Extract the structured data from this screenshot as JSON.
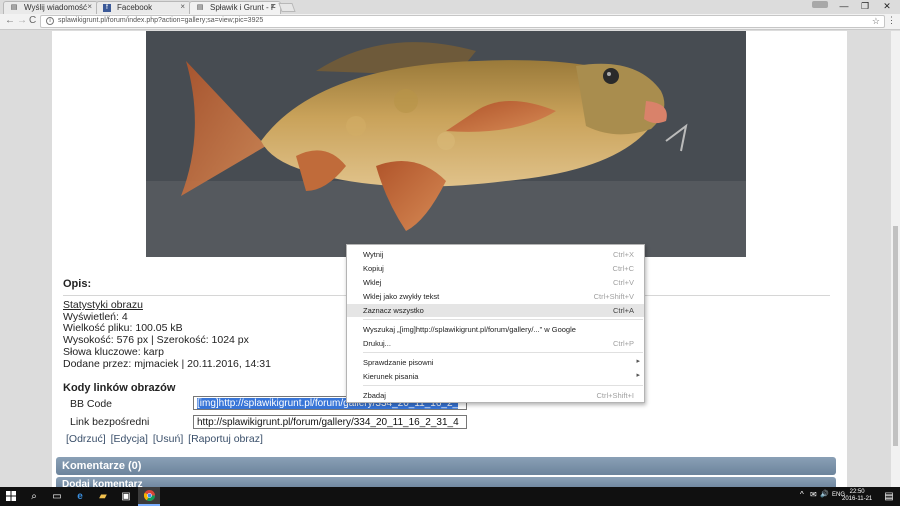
{
  "browser": {
    "tabs": [
      {
        "title": "Wyślij wiadomość",
        "icon": "document-icon",
        "active": false
      },
      {
        "title": "Facebook",
        "icon": "facebook-icon",
        "active": false
      },
      {
        "title": "Spławik i Grunt - F",
        "icon": "document-icon",
        "active": true
      }
    ],
    "close_glyph": "×",
    "url": "splawikigrunt.pl/forum/index.php?action=gallery;sa=view;pic=3925",
    "back": "←",
    "forward": "→",
    "reload": "C",
    "star": "☆",
    "menu": "⋮",
    "window_buttons": [
      "—",
      "❐",
      "✕"
    ],
    "profile_chip_color": "#a8a8a8"
  },
  "page": {
    "description_title": "Opis:",
    "stats_link": "Statystyki obrazu",
    "stats": [
      "Wyświetleń: 4",
      "Wielkość pliku: 100.05 kB",
      "Wysokość: 576 px | Szerokość: 1024 px",
      "Słowa kluczowe: karp",
      "Dodane przez: mjmaciek | 20.11.2016, 14:31"
    ],
    "codes_title": "Kody linków obrazów",
    "bb_code_label": "BB Code",
    "bb_code_value": "[img]http://splawikigrunt.pl/forum/gallery/334_20_11_16_2_",
    "direct_link_label": "Link bezpośredni",
    "direct_link_value": "http://splawikigrunt.pl/forum/gallery/334_20_11_16_2_31_4",
    "actions": [
      "[Odrzuć]",
      "[Edycja]",
      "[Usuń]",
      "[Raportuj obraz]"
    ],
    "comments_header": "Komentarze (0)",
    "add_comment_header": "Dodaj komentarz"
  },
  "context_menu": {
    "items": [
      {
        "label": "Wytnij",
        "shortcut": "Ctrl+X"
      },
      {
        "label": "Kopiuj",
        "shortcut": "Ctrl+C"
      },
      {
        "label": "Wklej",
        "shortcut": "Ctrl+V"
      },
      {
        "label": "Wklej jako zwykły tekst",
        "shortcut": "Ctrl+Shift+V"
      },
      {
        "label": "Zaznacz wszystko",
        "shortcut": "Ctrl+A"
      },
      {
        "label": "Wyszukaj „[img]http://splawikigrunt.pl/forum/gallery/...” w Google",
        "shortcut": ""
      },
      {
        "label": "Drukuj...",
        "shortcut": "Ctrl+P"
      },
      {
        "label": "Sprawdzanie pisowni",
        "shortcut": ""
      },
      {
        "label": "Kierunek pisania",
        "shortcut": ""
      },
      {
        "label": "Zbadaj",
        "shortcut": "Ctrl+Shift+I"
      }
    ],
    "submenu_arrow": "▸"
  },
  "taskbar": {
    "icons": [
      "windows-start-icon",
      "search-icon",
      "task-view-icon",
      "edge-icon",
      "file-explorer-icon",
      "store-icon",
      "chrome-icon"
    ],
    "tray": [
      "^",
      "✉",
      "🔊",
      "ENG"
    ],
    "time": "22:50",
    "date": "2016-11-21"
  },
  "colors": {
    "selection": "#3875d7",
    "header_bar": "#7a90a8",
    "hover_item": "#e5e5e5"
  }
}
